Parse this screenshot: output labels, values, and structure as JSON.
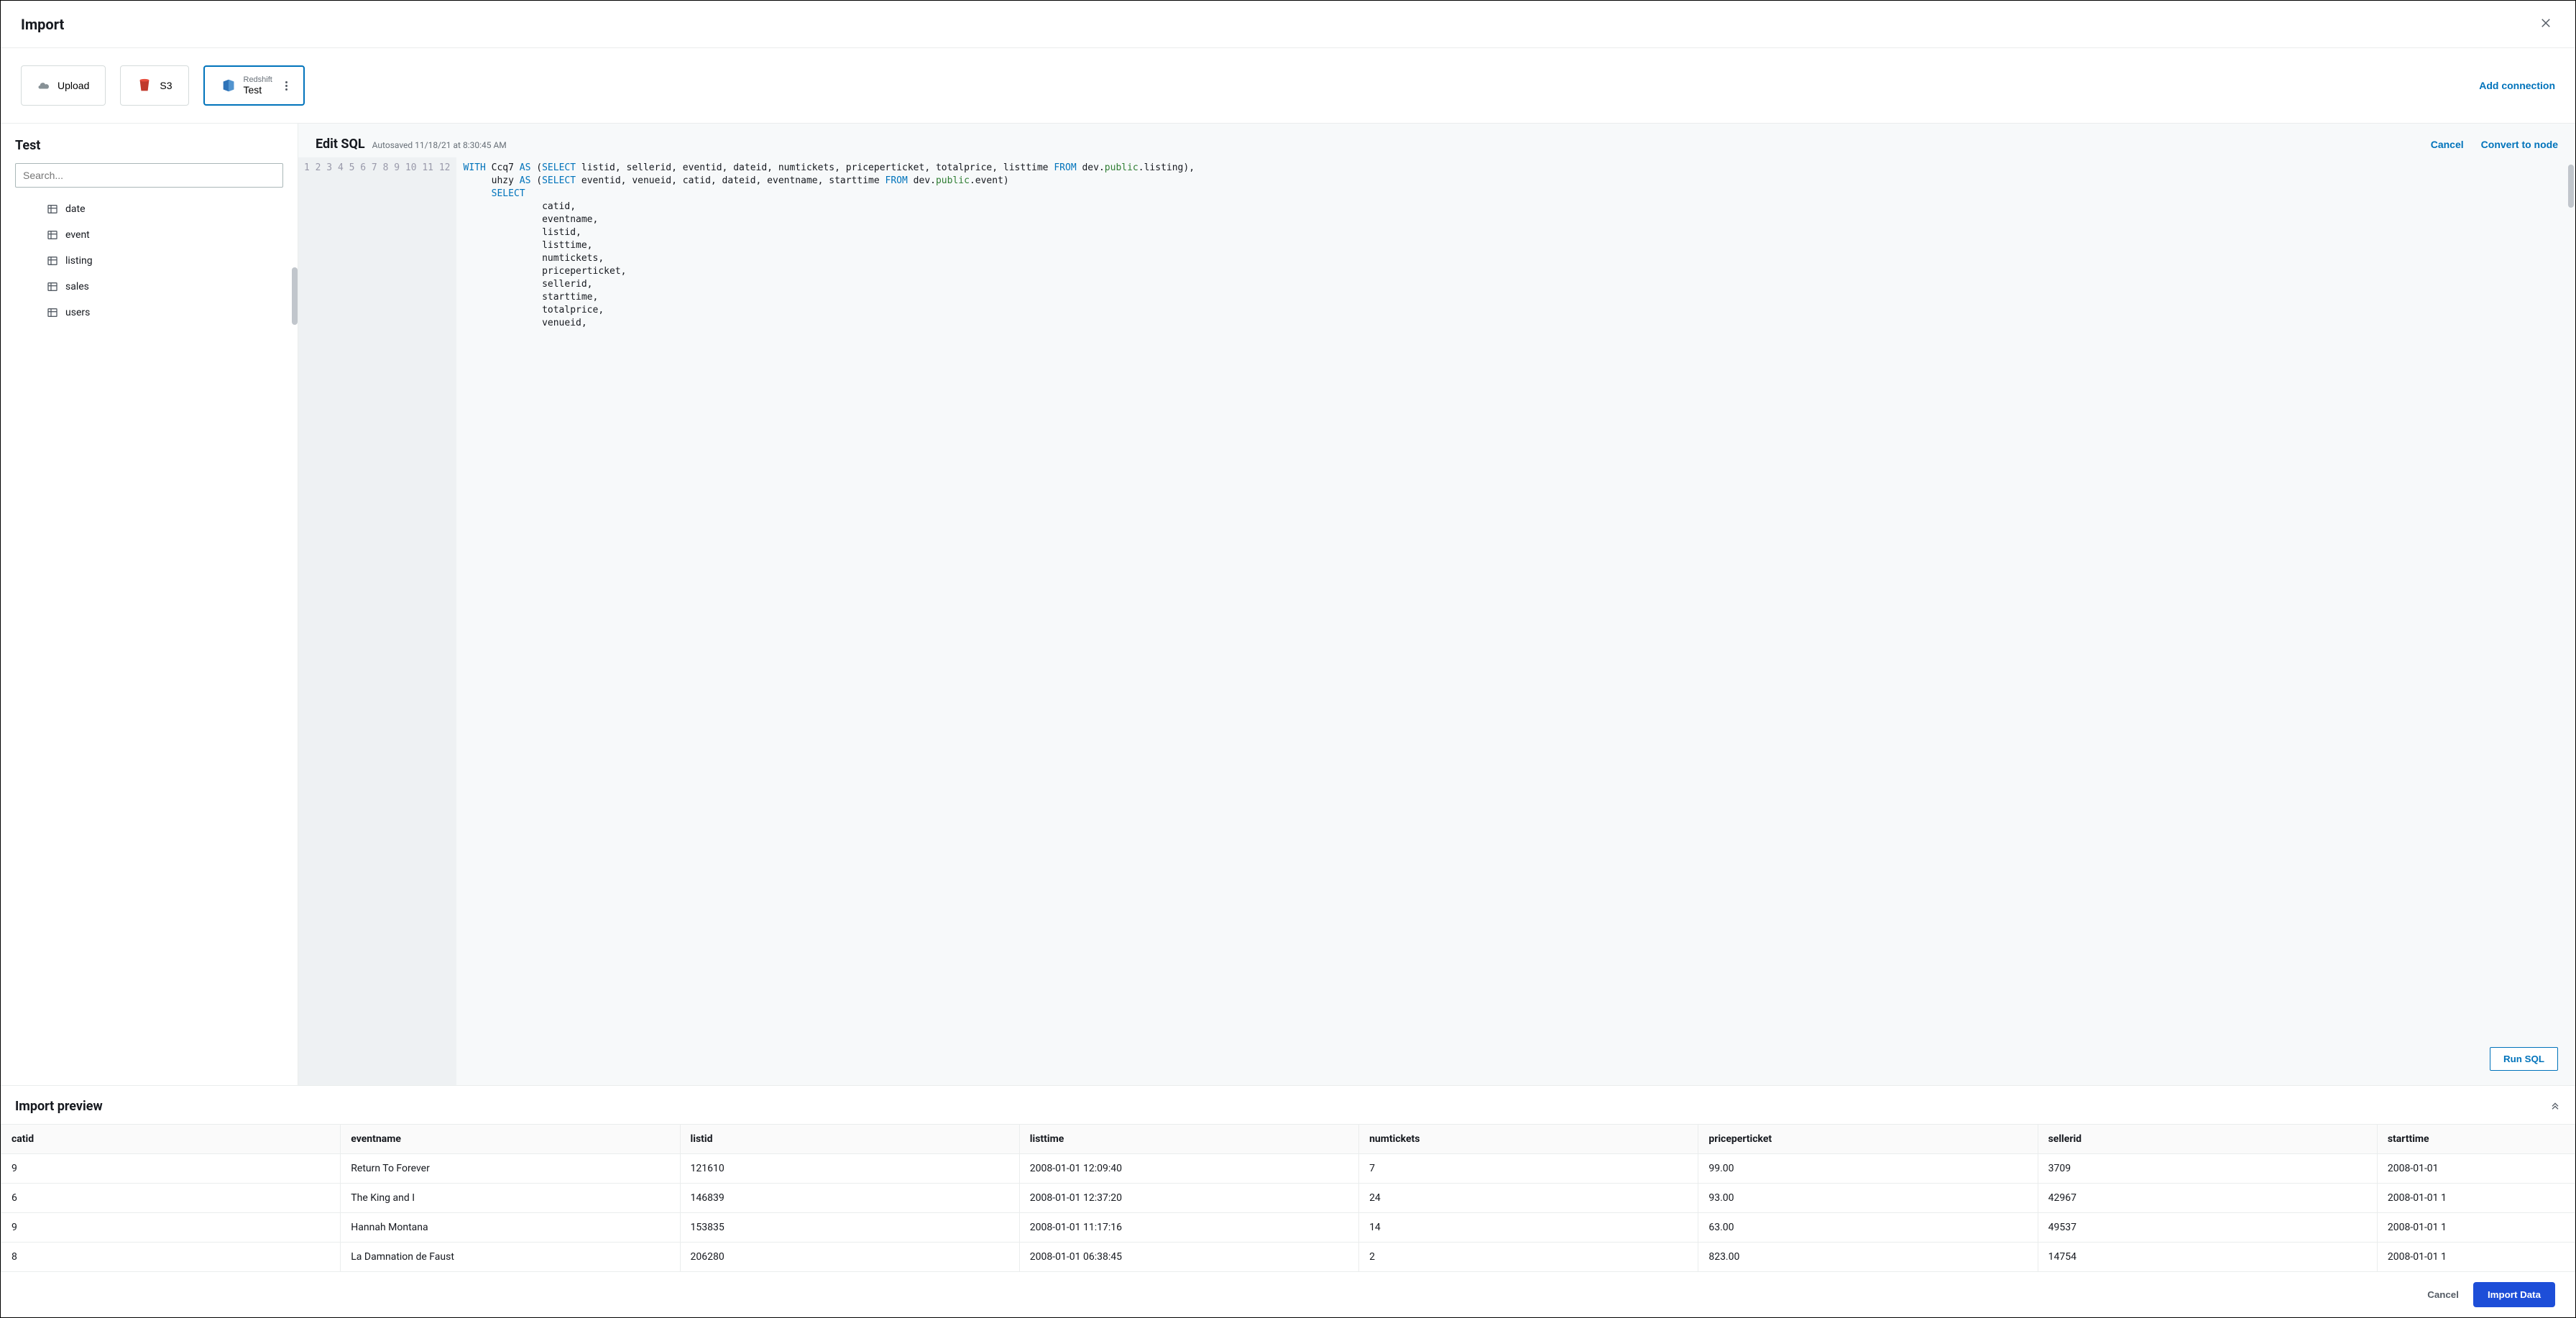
{
  "header": {
    "title": "Import"
  },
  "sources": {
    "upload": "Upload",
    "s3": "S3",
    "redshift_sub": "Redshift",
    "redshift_main": "Test",
    "add_connection": "Add connection"
  },
  "sidebar": {
    "title": "Test",
    "search_placeholder": "Search...",
    "tables": [
      "date",
      "event",
      "listing",
      "sales",
      "users"
    ]
  },
  "editor": {
    "title": "Edit SQL",
    "autosave": "Autosaved 11/18/21 at 8:30:45 AM",
    "cancel": "Cancel",
    "convert": "Convert to node",
    "run": "Run SQL",
    "lines": [
      "1",
      "2",
      "3",
      "4",
      "5",
      "6",
      "7",
      "8",
      "9",
      "10",
      "11",
      "12"
    ]
  },
  "preview": {
    "title": "Import preview",
    "columns": [
      "catid",
      "eventname",
      "listid",
      "listtime",
      "numtickets",
      "priceperticket",
      "sellerid",
      "starttime"
    ],
    "rows": [
      [
        "9",
        "Return To Forever",
        "121610",
        "2008-01-01 12:09:40",
        "7",
        "99.00",
        "3709",
        "2008-01-01"
      ],
      [
        "6",
        "The King and I",
        "146839",
        "2008-01-01 12:37:20",
        "24",
        "93.00",
        "42967",
        "2008-01-01 1"
      ],
      [
        "9",
        "Hannah Montana",
        "153835",
        "2008-01-01 11:17:16",
        "14",
        "63.00",
        "49537",
        "2008-01-01 1"
      ],
      [
        "8",
        "La Damnation de Faust",
        "206280",
        "2008-01-01 06:38:45",
        "2",
        "823.00",
        "14754",
        "2008-01-01 1"
      ]
    ]
  },
  "footer": {
    "cancel": "Cancel",
    "import": "Import Data"
  }
}
